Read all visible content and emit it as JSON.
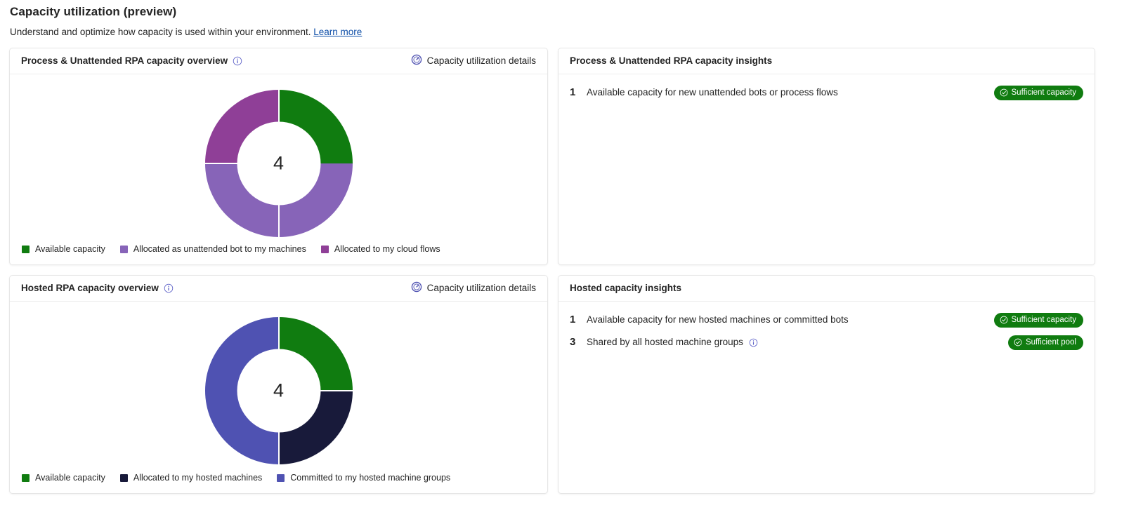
{
  "page": {
    "title": "Capacity utilization (preview)",
    "subtitle": "Understand and optimize how capacity is used within your environment.",
    "learn_more": "Learn more"
  },
  "colors": {
    "green": "#107c10",
    "light_purple": "#8764b8",
    "magenta_purple": "#8f3f97",
    "dark_navy": "#181a3a",
    "indigo": "#4f52b2",
    "badge_green": "#107c10",
    "link_blue": "#0f4fa8",
    "info_icon_blue": "#5b5fc7"
  },
  "cards": {
    "process_overview": {
      "title": "Process & Unattended RPA capacity overview",
      "info_icon": "info-icon",
      "details_link": {
        "label": "Capacity utilization details",
        "icon": "gauge-icon"
      },
      "chart_data": {
        "type": "pie",
        "title": "Process & Unattended RPA capacity overview",
        "center_value": "4",
        "total": 4,
        "categories": [
          "Available capacity",
          "Allocated as unattended bot to my machines",
          "Allocated to my cloud flows"
        ],
        "values": [
          1,
          2,
          1
        ],
        "percentages": [
          25,
          50,
          25
        ],
        "colors": [
          "#107c10",
          "#8764b8",
          "#8f3f97"
        ],
        "legend_position": "bottom",
        "donut": true
      }
    },
    "process_insights": {
      "title": "Process & Unattended RPA capacity insights",
      "rows": [
        {
          "count": "1",
          "text": "Available capacity for new unattended bots or process flows",
          "badge": {
            "label": "Sufficient capacity",
            "icon": "check-circle-icon"
          },
          "info_icon": null
        }
      ]
    },
    "hosted_overview": {
      "title": "Hosted RPA capacity overview",
      "info_icon": "info-icon",
      "details_link": {
        "label": "Capacity utilization details",
        "icon": "gauge-icon"
      },
      "chart_data": {
        "type": "pie",
        "title": "Hosted RPA capacity overview",
        "center_value": "4",
        "total": 4,
        "categories": [
          "Available capacity",
          "Allocated to my hosted machines",
          "Committed to my hosted machine groups"
        ],
        "values": [
          1,
          1,
          2
        ],
        "percentages": [
          25,
          25,
          50
        ],
        "colors": [
          "#107c10",
          "#181a3a",
          "#4f52b2"
        ],
        "legend_position": "bottom",
        "donut": true
      }
    },
    "hosted_insights": {
      "title": "Hosted capacity insights",
      "rows": [
        {
          "count": "1",
          "text": "Available capacity for new hosted machines or committed bots",
          "badge": {
            "label": "Sufficient capacity",
            "icon": "check-circle-icon"
          },
          "info_icon": null
        },
        {
          "count": "3",
          "text": "Shared by all hosted machine groups",
          "badge": {
            "label": "Sufficient pool",
            "icon": "check-circle-icon"
          },
          "info_icon": "info-icon"
        }
      ]
    }
  }
}
